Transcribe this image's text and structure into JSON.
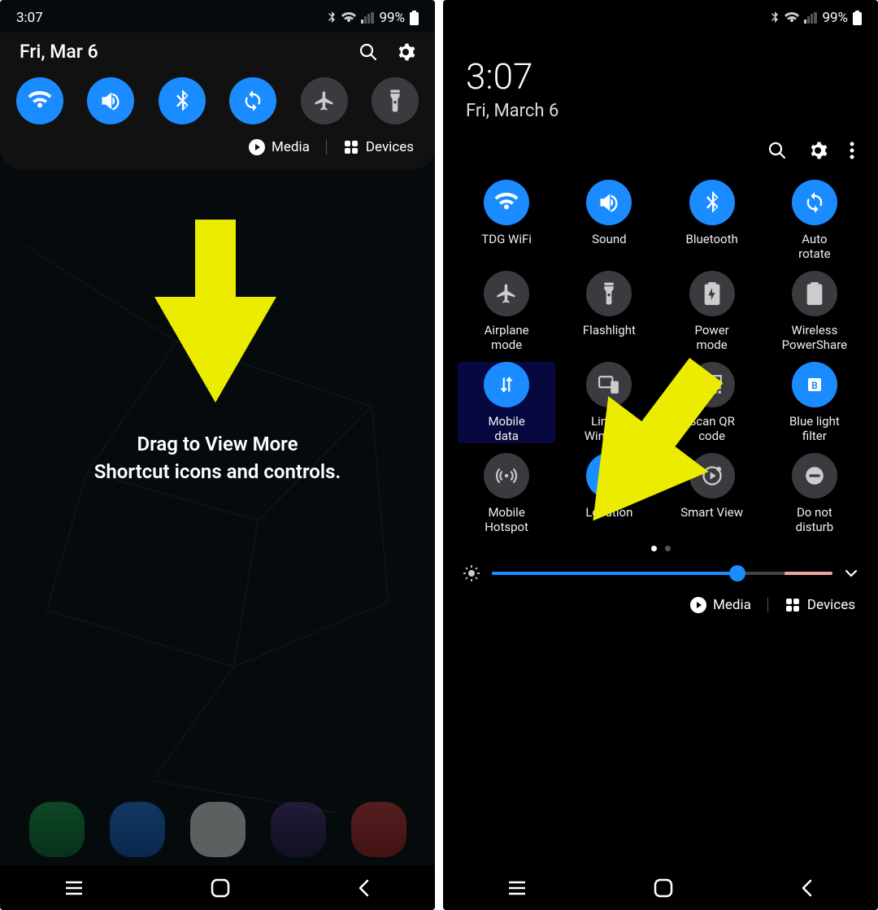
{
  "left": {
    "status": {
      "time": "3:07",
      "battery_pct": "99%"
    },
    "date": "Fri, Mar 6",
    "quick_toggles": [
      {
        "name": "wifi",
        "on": true
      },
      {
        "name": "sound",
        "on": true
      },
      {
        "name": "bluetooth",
        "on": true
      },
      {
        "name": "auto-rotate",
        "on": true
      },
      {
        "name": "airplane",
        "on": false
      },
      {
        "name": "flashlight",
        "on": false
      }
    ],
    "media_label": "Media",
    "devices_label": "Devices",
    "instruction_line1": "Drag to View More",
    "instruction_line2": "Shortcut icons and controls."
  },
  "right": {
    "status": {
      "battery_pct": "99%"
    },
    "time": "3:07",
    "date": "Fri, March 6",
    "qs_items": [
      {
        "label": "TDG WiFi",
        "name": "wifi",
        "on": true
      },
      {
        "label": "Sound",
        "name": "sound",
        "on": true
      },
      {
        "label": "Bluetooth",
        "name": "bluetooth",
        "on": true
      },
      {
        "label": "Auto\nrotate",
        "name": "auto-rotate",
        "on": true
      },
      {
        "label": "Airplane\nmode",
        "name": "airplane",
        "on": false
      },
      {
        "label": "Flashlight",
        "name": "flashlight",
        "on": false
      },
      {
        "label": "Power\nmode",
        "name": "power-mode",
        "on": false
      },
      {
        "label": "Wireless\nPowerShare",
        "name": "powershare",
        "on": false
      },
      {
        "label": "Mobile\ndata",
        "name": "mobile-data",
        "on": true,
        "highlight": true
      },
      {
        "label": "Link to\nWindows",
        "name": "link-windows",
        "on": false
      },
      {
        "label": "Scan QR\ncode",
        "name": "scan-qr",
        "on": false
      },
      {
        "label": "Blue light\nfilter",
        "name": "blue-light",
        "on": true
      },
      {
        "label": "Mobile\nHotspot",
        "name": "hotspot",
        "on": false
      },
      {
        "label": "Location",
        "name": "location",
        "on": true
      },
      {
        "label": "Smart View",
        "name": "smart-view",
        "on": false
      },
      {
        "label": "Do not\ndisturb",
        "name": "dnd",
        "on": false
      }
    ],
    "brightness_pct": 72,
    "media_label": "Media",
    "devices_label": "Devices"
  },
  "colors": {
    "accent": "#1a8cff",
    "off": "#3a3a3f",
    "arrow": "#ecec00"
  }
}
